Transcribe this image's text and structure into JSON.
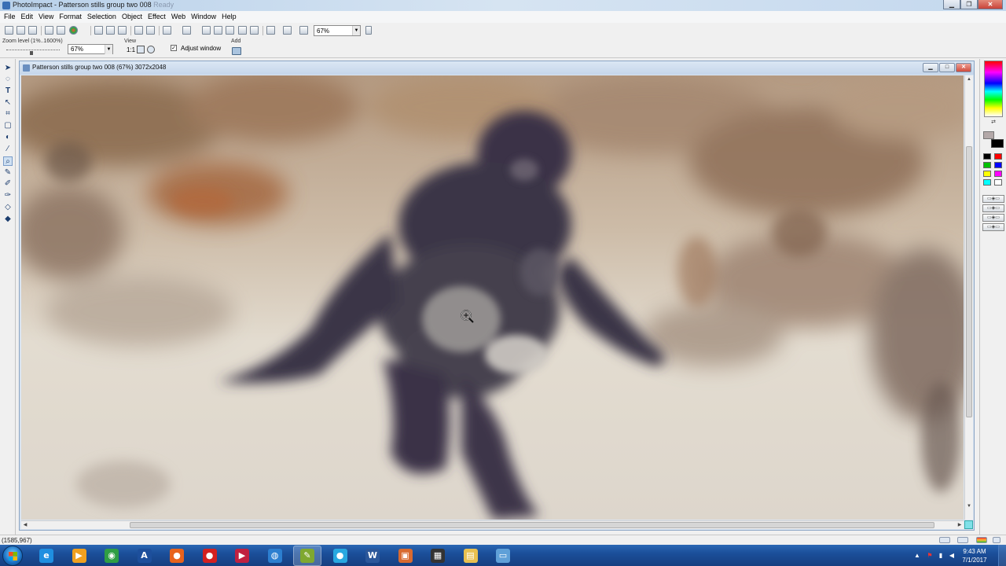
{
  "app": {
    "title_main": "PhotoImpact - Patterson stills group two 008",
    "title_dim": "Ready"
  },
  "menu": [
    "File",
    "Edit",
    "View",
    "Format",
    "Selection",
    "Object",
    "Effect",
    "Web",
    "Window",
    "Help"
  ],
  "toolbar": {
    "zoom_value": "67%"
  },
  "attributes": {
    "zoom_level_label": "Zoom level (1%..1600%)",
    "zoom_value": "67%",
    "view_label": "View",
    "view_value": "1:1",
    "adjust_window_label": "Adjust window",
    "adjust_window_checked": true,
    "add_label": "Add"
  },
  "document": {
    "title": "Patterson stills group two 008 (67%) 3072x2048"
  },
  "status": {
    "coords": "(1585,967)"
  },
  "clock": {
    "time": "9:43 AM",
    "date": "7/1/2017"
  },
  "colors": {
    "foreground": "#b3a8a8",
    "background": "#000000",
    "swatches": [
      "#000000",
      "#ff0000",
      "#00c000",
      "#0000ff",
      "#ffff00",
      "#ff00ff",
      "#00ffff",
      "#ffffff"
    ]
  },
  "tools": [
    "pointer-tool-icon",
    "lasso-tool-icon",
    "text-tool-icon",
    "pick-tool-icon",
    "crop-tool-icon",
    "transform-tool-icon",
    "bucket-tool-icon",
    "eyedropper-tool-icon",
    "zoom-tool-icon",
    "brush-tool-icon",
    "retouch-tool-icon",
    "clone-tool-icon",
    "eraser-tool-icon",
    "fill-tool-icon"
  ],
  "taskbar": {
    "apps": [
      {
        "name": "internet-explorer",
        "glyph": "e",
        "color": "#1f8fe0"
      },
      {
        "name": "media-player",
        "glyph": "▶",
        "color": "#f0a020"
      },
      {
        "name": "chrome",
        "glyph": "◉",
        "color": "#2f9e44"
      },
      {
        "name": "ani-app",
        "glyph": "A",
        "color": "#1d4f9c"
      },
      {
        "name": "firefox",
        "glyph": "●",
        "color": "#e8621c"
      },
      {
        "name": "record-app",
        "glyph": "●",
        "color": "#d42020"
      },
      {
        "name": "flag-app",
        "glyph": "▶",
        "color": "#c02040"
      },
      {
        "name": "globe-app",
        "glyph": "◍",
        "color": "#2c7fd0"
      },
      {
        "name": "photoimpact",
        "glyph": "✎",
        "color": "#7fa830"
      },
      {
        "name": "circle-app",
        "glyph": "●",
        "color": "#28a8e0"
      },
      {
        "name": "word",
        "glyph": "W",
        "color": "#2b579a"
      },
      {
        "name": "image-viewer",
        "glyph": "▣",
        "color": "#d86a30"
      },
      {
        "name": "device-app",
        "glyph": "▦",
        "color": "#333333"
      },
      {
        "name": "file-explorer",
        "glyph": "▤",
        "color": "#e8c050"
      },
      {
        "name": "window-app",
        "glyph": "▭",
        "color": "#5fa0d8"
      }
    ]
  }
}
